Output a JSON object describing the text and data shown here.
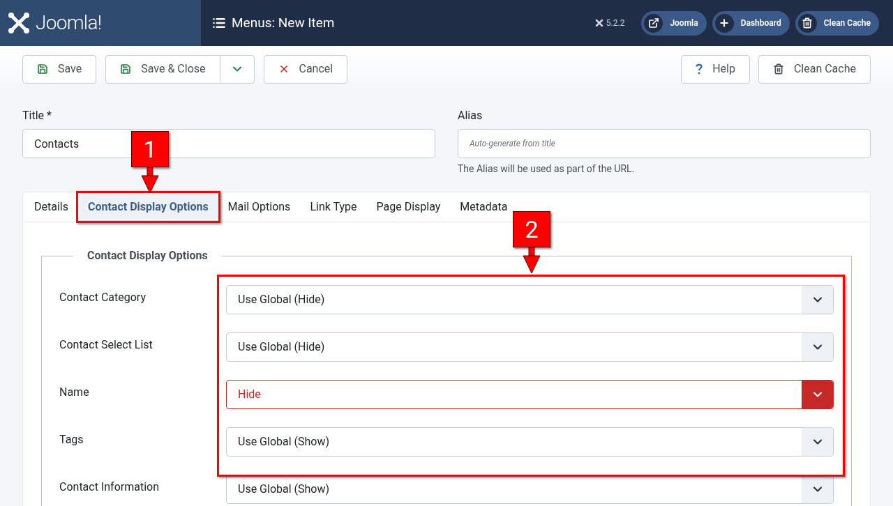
{
  "header": {
    "logo": "Joomla!",
    "title": "Menus: New Item",
    "version": "5.2.2",
    "links": [
      {
        "kind": "external",
        "label": "Joomla"
      },
      {
        "kind": "plus",
        "label": "Dashboard"
      },
      {
        "kind": "trash",
        "label": "Clean Cache"
      }
    ]
  },
  "toolbar": {
    "left": [
      {
        "kind": "save",
        "label": "Save"
      },
      {
        "kind": "save-split",
        "label": "Save & Close"
      },
      {
        "kind": "cancel",
        "label": "Cancel"
      }
    ],
    "right": [
      {
        "kind": "help",
        "label": "Help"
      },
      {
        "kind": "trash",
        "label": "Clean Cache"
      }
    ]
  },
  "title_field": {
    "label": "Title *",
    "value": "Contacts"
  },
  "alias_field": {
    "label": "Alias",
    "placeholder": "Auto-generate from title",
    "hint": "The Alias will be used as part of the URL."
  },
  "tabs": [
    {
      "label": "Details",
      "selected": false
    },
    {
      "label": "Contact Display Options",
      "selected": true
    },
    {
      "label": "Mail Options",
      "selected": false
    },
    {
      "label": "Link Type",
      "selected": false
    },
    {
      "label": "Page Display",
      "selected": false
    },
    {
      "label": "Metadata",
      "selected": false
    }
  ],
  "fieldset": {
    "legend": "Contact Display Options",
    "rows": [
      {
        "label": "Contact Category",
        "value": "Use Global (Hide)",
        "invalid": false
      },
      {
        "label": "Contact Select List",
        "value": "Use Global (Hide)",
        "invalid": false
      },
      {
        "label": "Name",
        "value": "Hide",
        "invalid": true
      },
      {
        "label": "Tags",
        "value": "Use Global (Show)",
        "invalid": false
      },
      {
        "label": "Contact Information",
        "value": "Use Global (Show)",
        "invalid": false
      }
    ]
  },
  "annotations": [
    {
      "number": "1"
    },
    {
      "number": "2"
    }
  ]
}
